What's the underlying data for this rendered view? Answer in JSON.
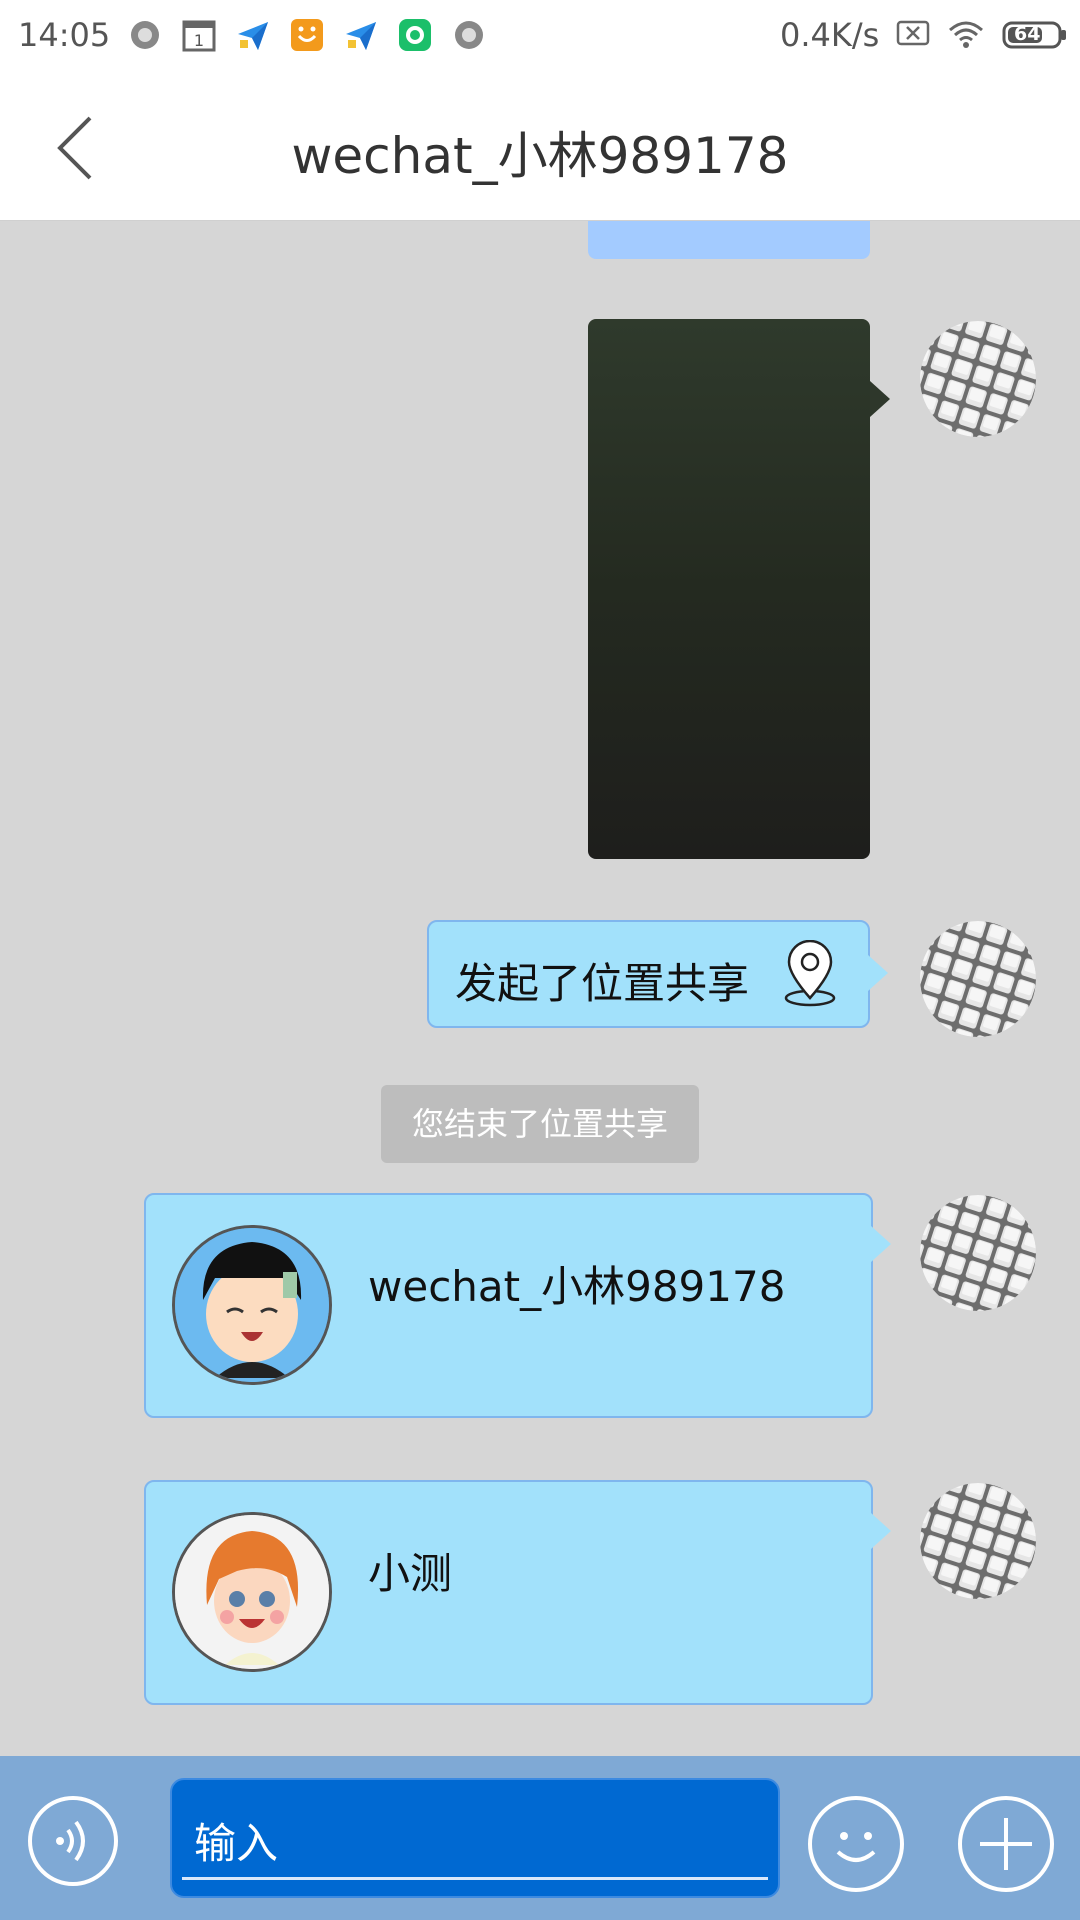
{
  "status_bar": {
    "time": "14:05",
    "notification_icons": [
      "circle-icon",
      "calendar-icon",
      "send-icon",
      "smile-app-icon",
      "send-icon",
      "app-icon",
      "circle-icon"
    ],
    "calendar_day": "1",
    "net_speed": "0.4K/s",
    "battery": "64"
  },
  "header": {
    "back_icon": "chevron-left-icon",
    "title": "wechat_小林989178"
  },
  "messages": [
    {
      "type": "partial-bubble"
    },
    {
      "type": "image",
      "side": "right",
      "content": "dark photo"
    },
    {
      "type": "text",
      "side": "right",
      "text": "发起了位置共享",
      "icon": "location-pin-icon"
    },
    {
      "type": "system",
      "text": "您结束了位置共享"
    },
    {
      "type": "card",
      "side": "right",
      "name": "wechat_小林989178",
      "avatar": "boy-avatar-icon"
    },
    {
      "type": "card",
      "side": "right",
      "name": "小测",
      "avatar": "girl-avatar-icon"
    }
  ],
  "input_bar": {
    "voice_icon": "voice-icon",
    "placeholder": "输入",
    "emoji_icon": "emoji-icon",
    "plus_icon": "plus-icon"
  },
  "colors": {
    "bubble": "#a2e1fb",
    "bubble_border": "#7fb6ee",
    "input_bar": "#7fa9d5",
    "input_field": "#0069d2",
    "chat_bg": "#d6d6d6"
  }
}
